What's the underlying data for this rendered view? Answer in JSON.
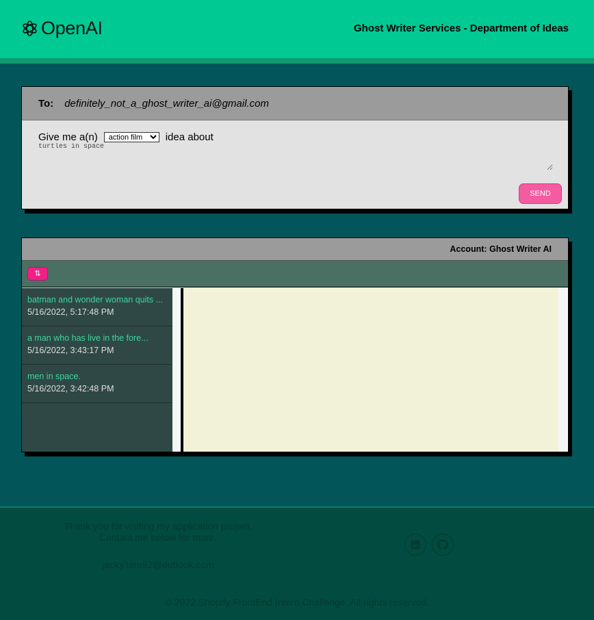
{
  "header": {
    "brand": "OpenAI",
    "logo_icon": "openai-logo-icon",
    "title": "Ghost Writer Services - Department of Ideas"
  },
  "compose": {
    "to_label": "To:",
    "to_address": "definitely_not_a_ghost_writer_ai@gmail.com",
    "prompt_prefix": "Give me a(n)",
    "genre_selected": "action film",
    "prompt_suffix": "idea about",
    "topic_value": "turtles in space",
    "send_label": "SEND"
  },
  "inbox": {
    "account_label": "Account: Ghost Writer AI",
    "sort_button_label": "⇅",
    "messages": [
      {
        "subject": "batman and wonder woman quits ...",
        "date": "5/16/2022, 5:17:48 PM"
      },
      {
        "subject": "a man who has live in the fore...",
        "date": "5/16/2022, 3:43:17 PM"
      },
      {
        "subject": "men in space.",
        "date": "5/16/2022, 3:42:48 PM"
      }
    ]
  },
  "footer": {
    "thanks_line1": "Thank you for visiting my application project.",
    "thanks_line2": "Contact me below for more.",
    "email": "jacky.tam92@outlook.com",
    "social_icons": [
      "linkedin-icon",
      "github-icon"
    ],
    "copyright": "© 2022 Shopify FrontEnd Intern Challenge. All rights reserved."
  },
  "colors": {
    "header": "#01c993",
    "background": "#02565a",
    "accent_pink": "#f45ba0",
    "subject_green": "#3dd59a",
    "footer": "#024b40"
  }
}
